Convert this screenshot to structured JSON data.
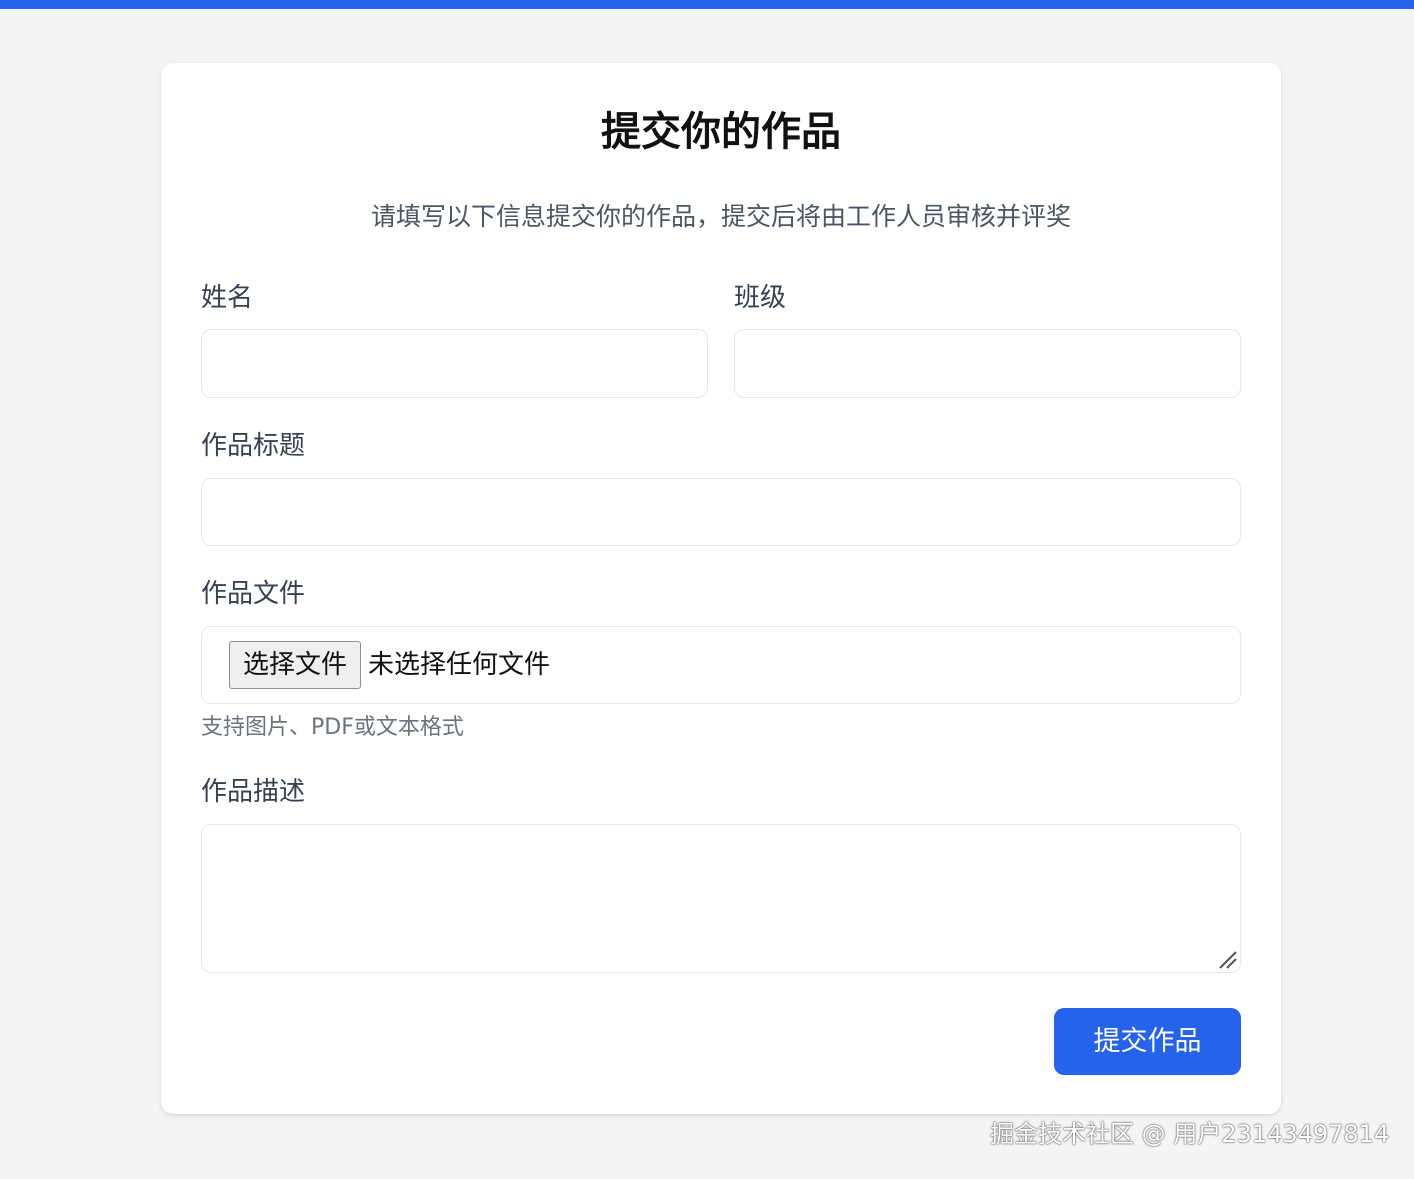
{
  "colors": {
    "accent": "#2563eb",
    "page_bg": "#f3f4f6",
    "card_bg": "#ffffff"
  },
  "form": {
    "title": "提交你的作品",
    "subtitle": "请填写以下信息提交你的作品，提交后将由工作人员审核并评奖",
    "name_label": "姓名",
    "name_value": "",
    "class_label": "班级",
    "class_value": "",
    "work_title_label": "作品标题",
    "work_title_value": "",
    "file_label": "作品文件",
    "file_button": "选择文件",
    "file_status": "未选择任何文件",
    "file_hint": "支持图片、PDF或文本格式",
    "description_label": "作品描述",
    "description_value": "",
    "submit_label": "提交作品"
  },
  "watermark": "掘金技术社区 @ 用户23143497814",
  "icons": {
    "resize": "resize-grip-icon"
  }
}
